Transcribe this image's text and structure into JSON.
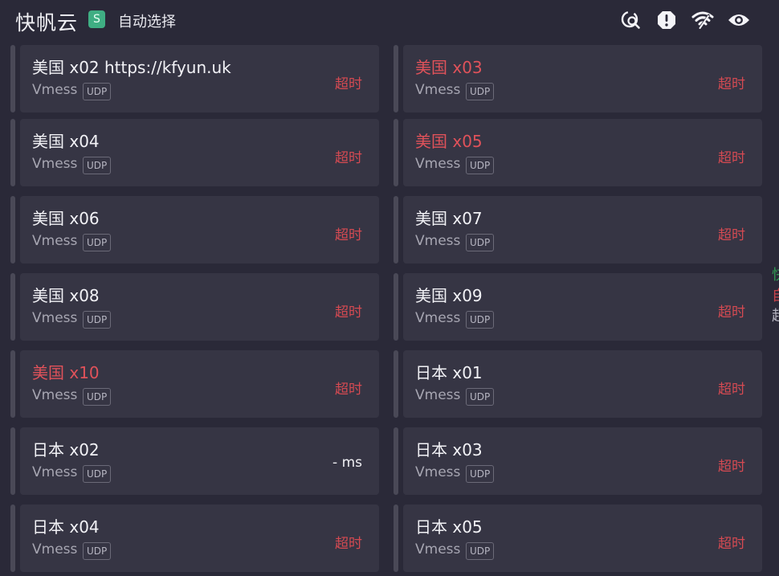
{
  "header": {
    "title": "快帆云",
    "type_badge": "S",
    "mode": "自动选择",
    "icons": [
      "search-speed-icon",
      "alert-icon",
      "wifi-icon",
      "eye-icon"
    ]
  },
  "colors": {
    "timeout": "#d54a52",
    "warn_name": "#e0525a",
    "card": "#363544",
    "background": "#2a2938"
  },
  "nodes": [
    {
      "name": "美国 x02 https://kfyun.uk",
      "protocol": "Vmess",
      "tag": "UDP",
      "delay": "超时",
      "name_warn": false,
      "delay_ok": false
    },
    {
      "name": "美国 x03",
      "protocol": "Vmess",
      "tag": "UDP",
      "delay": "超时",
      "name_warn": true,
      "delay_ok": false
    },
    {
      "name": "美国 x04",
      "protocol": "Vmess",
      "tag": "UDP",
      "delay": "超时",
      "name_warn": false,
      "delay_ok": false
    },
    {
      "name": "美国 x05",
      "protocol": "Vmess",
      "tag": "UDP",
      "delay": "超时",
      "name_warn": true,
      "delay_ok": false
    },
    {
      "name": "美国 x06",
      "protocol": "Vmess",
      "tag": "UDP",
      "delay": "超时",
      "name_warn": false,
      "delay_ok": false
    },
    {
      "name": "美国 x07",
      "protocol": "Vmess",
      "tag": "UDP",
      "delay": "超时",
      "name_warn": false,
      "delay_ok": false
    },
    {
      "name": "美国 x08",
      "protocol": "Vmess",
      "tag": "UDP",
      "delay": "超时",
      "name_warn": false,
      "delay_ok": false
    },
    {
      "name": "美国 x09",
      "protocol": "Vmess",
      "tag": "UDP",
      "delay": "超时",
      "name_warn": false,
      "delay_ok": false
    },
    {
      "name": "美国 x10",
      "protocol": "Vmess",
      "tag": "UDP",
      "delay": "超时",
      "name_warn": true,
      "delay_ok": false
    },
    {
      "name": "日本 x01",
      "protocol": "Vmess",
      "tag": "UDP",
      "delay": "超时",
      "name_warn": false,
      "delay_ok": false
    },
    {
      "name": "日本 x02",
      "protocol": "Vmess",
      "tag": "UDP",
      "delay": "- ms",
      "name_warn": false,
      "delay_ok": true
    },
    {
      "name": "日本 x03",
      "protocol": "Vmess",
      "tag": "UDP",
      "delay": "超时",
      "name_warn": false,
      "delay_ok": false
    },
    {
      "name": "日本 x04",
      "protocol": "Vmess",
      "tag": "UDP",
      "delay": "超时",
      "name_warn": false,
      "delay_ok": false
    },
    {
      "name": "日本 x05",
      "protocol": "Vmess",
      "tag": "UDP",
      "delay": "超时",
      "name_warn": false,
      "delay_ok": false
    }
  ],
  "side_peek": [
    "快",
    "自",
    "超"
  ]
}
